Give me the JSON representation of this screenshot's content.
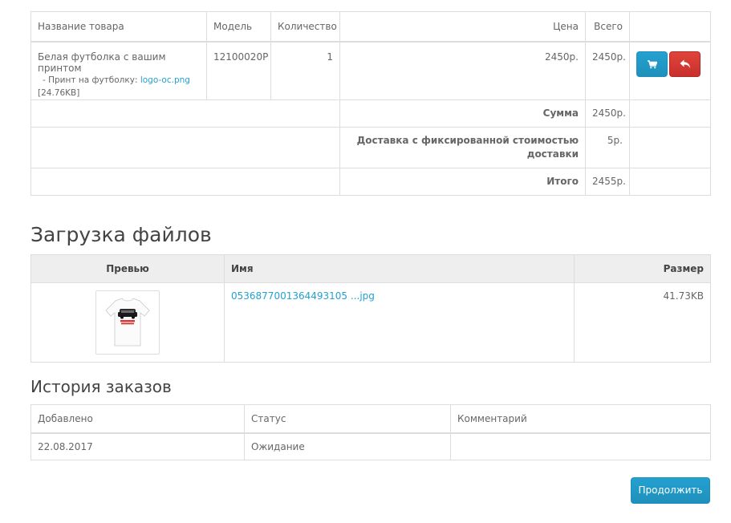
{
  "order": {
    "columns": [
      "Название товара",
      "Модель",
      "Количество",
      "Цена",
      "Всего"
    ],
    "product": {
      "name": "Белая футболка с вашим принтом",
      "option_prefix": "- Принт на футболку:",
      "option_file": "logo-oc.png",
      "option_size": "[24.76KB]",
      "model": "12100020P",
      "quantity": "1",
      "price": "2450р.",
      "total": "2450р."
    },
    "totals": [
      {
        "label": "Сумма",
        "value": "2450р."
      },
      {
        "label": "Доставка с фиксированной стоимостью доставки",
        "value": "5р."
      },
      {
        "label": "Итого",
        "value": "2455р."
      }
    ]
  },
  "uploads": {
    "title": "Загрузка файлов",
    "columns": [
      "Превью",
      "Имя",
      "Размер"
    ],
    "file": {
      "name": "0536877001364493105 ...jpg",
      "size": "41.73KB"
    }
  },
  "history": {
    "title": "История заказов",
    "columns": [
      "Добавлено",
      "Статус",
      "Комментарий"
    ],
    "row": {
      "date": "22.08.2017",
      "status": "Ожидание",
      "comment": ""
    }
  },
  "actions": {
    "continue_label": "Продолжить"
  },
  "colors": {
    "primary": "#23a1d1",
    "danger": "#d9534f",
    "border": "#dddddd"
  }
}
